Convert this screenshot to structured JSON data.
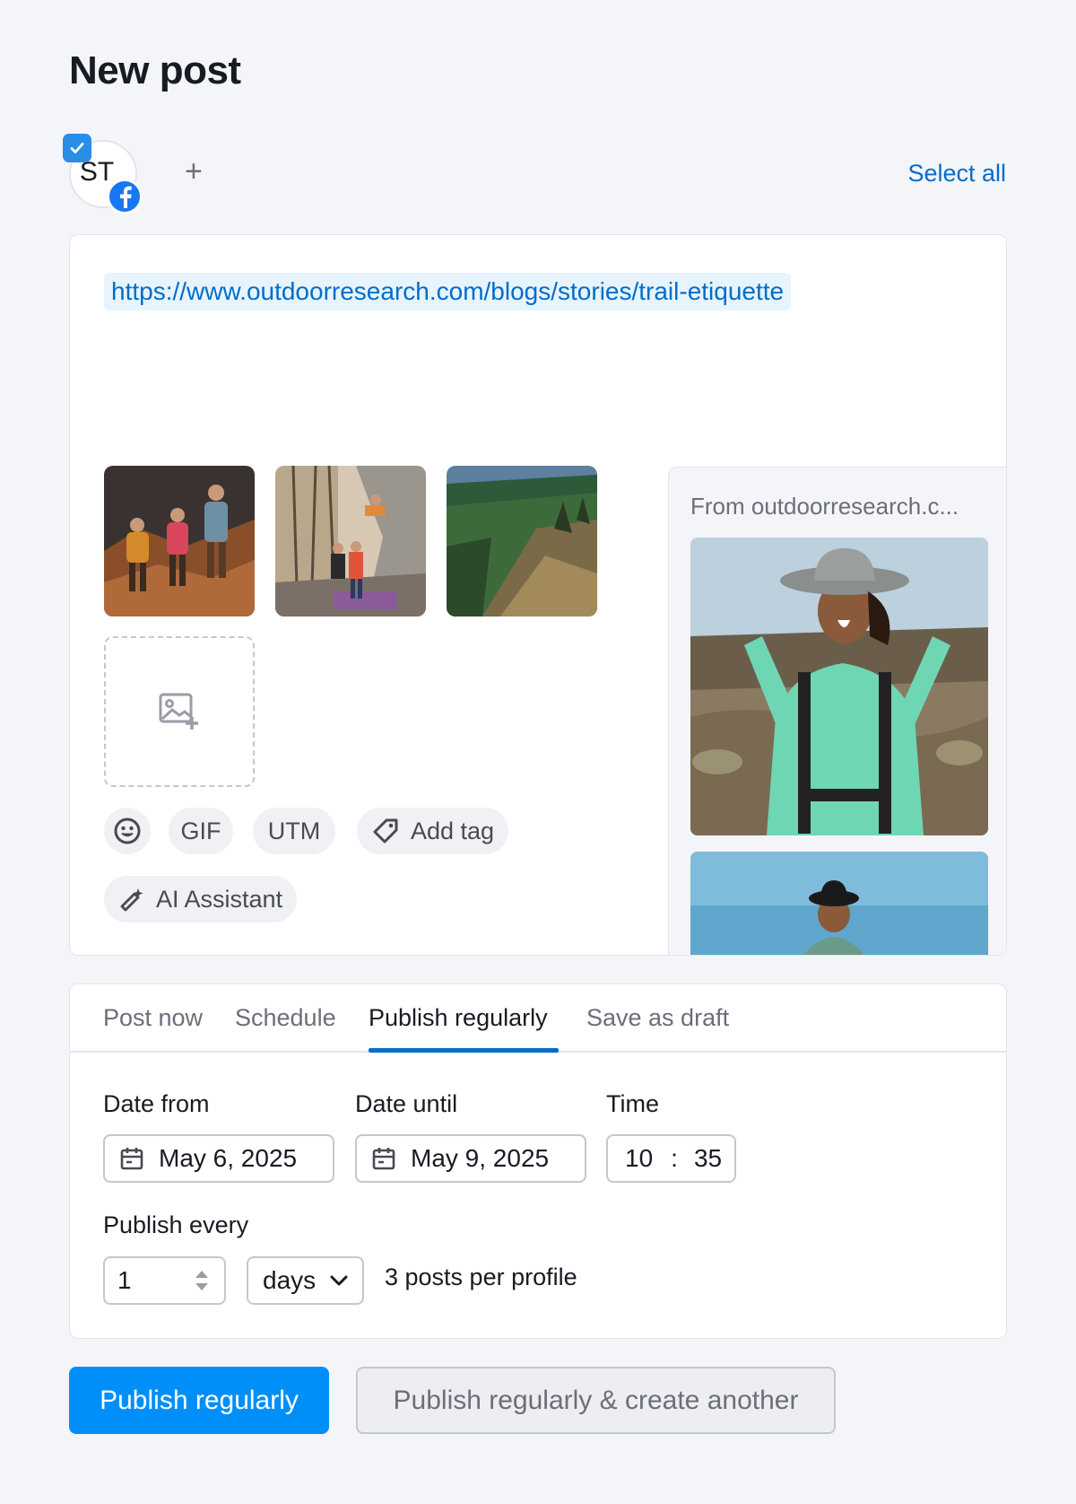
{
  "page": {
    "title": "New post"
  },
  "profiles": {
    "items": [
      {
        "initials": "ST",
        "network": "facebook",
        "selected": true
      }
    ],
    "add_label": "+",
    "select_all_label": "Select all"
  },
  "composer": {
    "link_text": "https://www.outdoorresearch.com/blogs/stories/trail-etiquette",
    "thumbnails": [
      "hikers-photo",
      "climbers-photo",
      "forest-hillside-photo"
    ],
    "upload_icon": "image-add-icon",
    "toolbar": {
      "emoji_icon": "smiley-icon",
      "gif_label": "GIF",
      "utm_label": "UTM",
      "add_tag_label": "Add tag",
      "ai_assistant_label": "AI Assistant"
    },
    "preview": {
      "source": "From outdoorresearch.c...",
      "images": [
        "hiker-woman-hat-photo",
        "hiker-bucket-hat-photo"
      ]
    }
  },
  "schedule": {
    "tabs": [
      {
        "label": "Post now",
        "active": false
      },
      {
        "label": "Schedule",
        "active": false
      },
      {
        "label": "Publish regularly",
        "active": true
      },
      {
        "label": "Save as draft",
        "active": false
      }
    ],
    "date_from": {
      "label": "Date from",
      "value": "May 6, 2025"
    },
    "date_until": {
      "label": "Date until",
      "value": "May 9, 2025"
    },
    "time": {
      "label": "Time",
      "hours": "10",
      "separator": ":",
      "minutes": "35"
    },
    "publish_every": {
      "label": "Publish every",
      "interval": "1",
      "unit": "days",
      "summary": "3 posts per profile"
    }
  },
  "actions": {
    "primary_label": "Publish regularly",
    "secondary_label": "Publish regularly & create another"
  },
  "colors": {
    "accent": "#006dca",
    "primary_button": "#008ff8",
    "facebook": "#1877f2",
    "background": "#f4f5f9"
  }
}
